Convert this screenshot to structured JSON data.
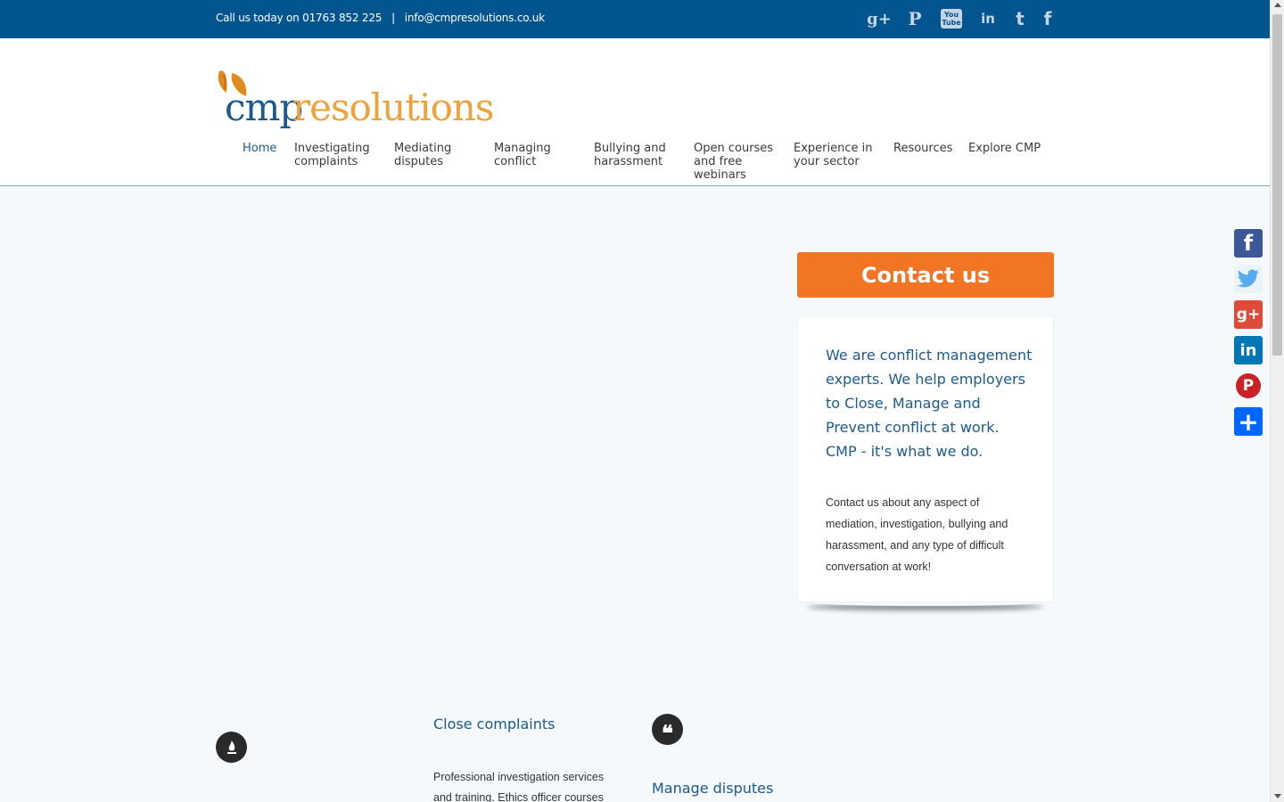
{
  "topbar": {
    "phone_prefix": "Call us today on 01763 852 225",
    "separator": "|",
    "email": "info@cmpresolutions.co.uk",
    "social_icons": [
      "google-plus-icon",
      "pinterest-icon",
      "youtube-icon",
      "linkedin-icon",
      "twitter-icon",
      "facebook-icon"
    ],
    "google_label": "g+",
    "pinterest_label": "P",
    "youtube_label": "You Tube",
    "linkedin_label": "in",
    "twitter_label": "t",
    "facebook_label": "f"
  },
  "logo": {
    "part1": "cmp",
    "part2": "resolutions"
  },
  "nav": {
    "items": [
      {
        "label": "Home"
      },
      {
        "label": "Investigating complaints"
      },
      {
        "label": "Mediating disputes"
      },
      {
        "label": "Managing conflict"
      },
      {
        "label": "Bullying and harassment"
      },
      {
        "label": "Open courses and free webinars"
      },
      {
        "label": "Experience in your sector"
      },
      {
        "label": "Resources"
      },
      {
        "label": "Explore CMP"
      }
    ]
  },
  "sidebar": {
    "contact_button": "Contact us",
    "lead": "We are conflict management experts. We help employers to Close, Manage and Prevent conflict at work. CMP - it's what we do.",
    "sub": "Contact us about any aspect of mediation, investigation, bullying and harassment, and any type of difficult conversation at work!"
  },
  "share": {
    "facebook": "f",
    "twitter": "t",
    "google": "g+",
    "linkedin": "in",
    "pinterest": "P",
    "more": "+"
  },
  "features": {
    "close_title": "Close complaints",
    "close_text": "Professional investigation services and training. Ethics officer courses",
    "manage_title": "Manage disputes"
  },
  "colors": {
    "brand_blue": "#03558f",
    "accent_orange": "#f27523",
    "logo_orange": "#eea23a"
  }
}
